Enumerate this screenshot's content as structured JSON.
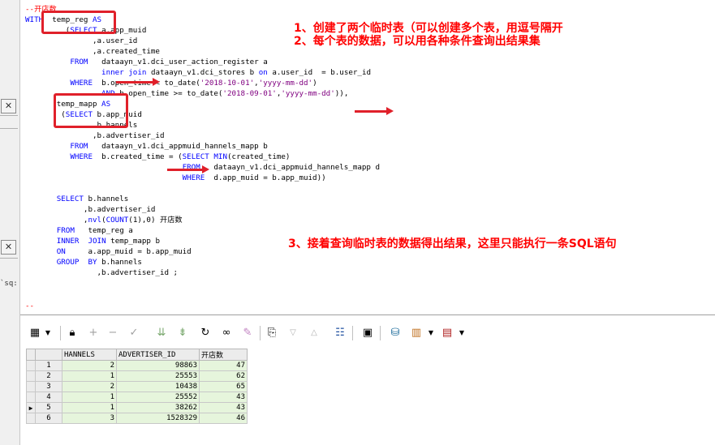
{
  "left_panel": {
    "close_glyph": "✕",
    "sq_label": "`sq:"
  },
  "code": {
    "comment_top": "--开店数",
    "lines": [
      "WITH  temp_reg AS",
      "         (SELECT a.app_muid",
      "               ,a.user_id",
      "               ,a.created_time",
      "          FROM   dataayn_v1.dci_user_action_register a",
      "                 inner join dataayn_v1.dci_stores b on a.user_id  = b.user_id",
      "          WHERE  b.open_time < to_date('2018-10-01','yyyy-mm-dd')",
      "                 AND b.open_time >= to_date('2018-09-01','yyyy-mm-dd')),",
      "       temp_mapp AS",
      "        (SELECT b.app_muid",
      "               ,b.hannels",
      "               ,b.advertiser_id",
      "          FROM   dataayn_v1.dci_appmuid_hannels_mapp b",
      "          WHERE  b.created_time = (SELECT MIN(created_time)",
      "                                   FROM   dataayn_v1.dci_appmuid_hannels_mapp d",
      "                                   WHERE  d.app_muid = b.app_muid))",
      "",
      "       SELECT b.hannels",
      "             ,b.advertiser_id",
      "             ,nvl(COUNT(1),0) 开店数",
      "       FROM   temp_reg a",
      "       INNER  JOIN temp_mapp b",
      "       ON     a.app_muid = b.app_muid",
      "       GROUP  BY b.hannels",
      "                ,b.advertiser_id ;"
    ],
    "comment_bottom": "--"
  },
  "annotations": {
    "note1": "1、创建了两个临时表（可以创建多个表，用逗号隔开",
    "note2": "2、每个表的数据，可以用各种条件查询出结果集",
    "note3": "3、接着查询临时表的数据得出结果，这里只能执行一条SQL语句"
  },
  "toolbar": {
    "icons": [
      "grid-icon",
      "lock-icon",
      "add-icon",
      "remove-icon",
      "check-icon",
      "fetch-next-icon",
      "fetch-last-icon",
      "refresh-icon",
      "binoculars-icon",
      "clear-icon",
      "export-icon",
      "filter-down-icon",
      "filter-up-icon",
      "tree-icon",
      "save-icon",
      "database-icon",
      "chart-icon",
      "table-icon"
    ]
  },
  "result_grid": {
    "columns": [
      "HANNELS",
      "ADVERTISER_ID",
      "开店数"
    ],
    "rows": [
      {
        "n": "1",
        "hannels": "2",
        "advertiser_id": "98863",
        "stores": "47"
      },
      {
        "n": "2",
        "hannels": "1",
        "advertiser_id": "25553",
        "stores": "62"
      },
      {
        "n": "3",
        "hannels": "2",
        "advertiser_id": "10438",
        "stores": "65"
      },
      {
        "n": "4",
        "hannels": "1",
        "advertiser_id": "25552",
        "stores": "43"
      },
      {
        "n": "5",
        "hannels": "1",
        "advertiser_id": "38262",
        "stores": "43"
      },
      {
        "n": "6",
        "hannels": "3",
        "advertiser_id": "1528329",
        "stores": "46"
      }
    ],
    "current_row_marker": "▶"
  },
  "colors": {
    "annotation": "#ff0000",
    "highlight_box": "#e0202a",
    "keyword": "#0000ff",
    "string": "#800080",
    "row_fill": "#e6f5dc"
  }
}
